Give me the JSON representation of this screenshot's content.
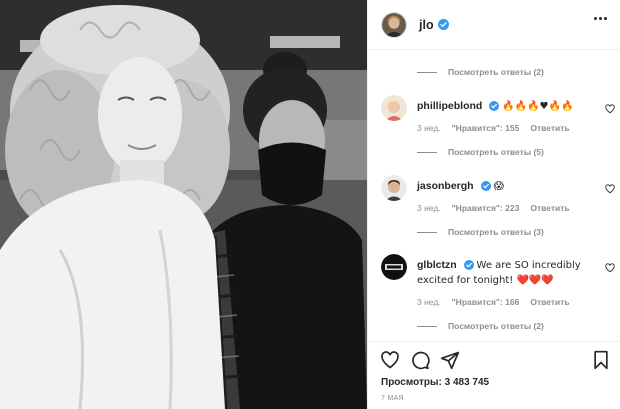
{
  "post": {
    "author": "jlo",
    "photo_alt": "photo"
  },
  "comments": [
    {
      "kind": "replies",
      "text": "Посмотреть ответы (2)"
    },
    {
      "kind": "comment",
      "user": "phillipeblond",
      "text": "🔥🔥🔥♥🔥🔥",
      "time": "3 нед.",
      "likes": "\"Нравится\": 155",
      "reply": "Ответить",
      "verified": true
    },
    {
      "kind": "replies",
      "text": "Посмотреть ответы (5)"
    },
    {
      "kind": "comment",
      "user": "jasonbergh",
      "text": "😱",
      "time": "3 нед.",
      "likes": "\"Нравится\": 223",
      "reply": "Ответить",
      "verified": true
    },
    {
      "kind": "replies",
      "text": "Посмотреть ответы (3)"
    },
    {
      "kind": "comment",
      "user": "glblctzn",
      "text": "We are SO incredibly excited for tonight! ❤️❤️❤️",
      "time": "3 нед.",
      "likes": "\"Нравится\": 166",
      "reply": "Ответить",
      "verified": true
    },
    {
      "kind": "replies",
      "text": "Посмотреть ответы (2)"
    }
  ],
  "stats": {
    "views": "Просмотры: 3 483 745",
    "date": "7 МАЯ"
  },
  "colors": {
    "verified": "#3897f0",
    "meta": "#8e8e8e",
    "text": "#262626"
  },
  "icons": [
    "more-icon",
    "heart-icon",
    "comment-icon",
    "share-icon",
    "bookmark-icon",
    "verified-icon"
  ]
}
